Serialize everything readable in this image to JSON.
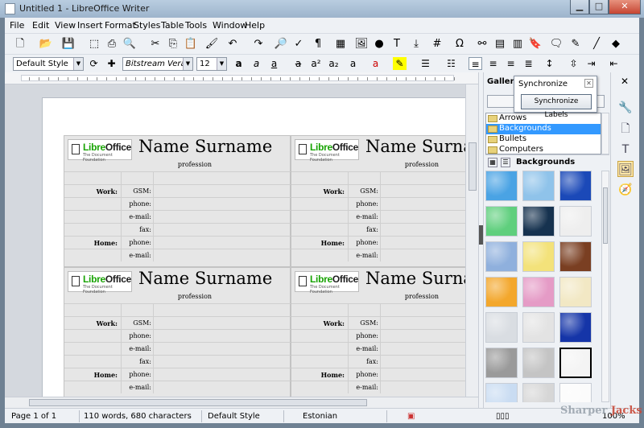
{
  "window": {
    "title": "Untitled 1 - LibreOffice Writer",
    "min": "▁",
    "max": "□",
    "close": "✕"
  },
  "menu": [
    "File",
    "Edit",
    "View",
    "Insert",
    "Format",
    "Styles",
    "Table",
    "Tools",
    "Window",
    "Help"
  ],
  "formatting": {
    "style": "Default Style",
    "font": "Bitstream Vera Sa",
    "size": "12"
  },
  "cards": [
    {
      "logo_libre": "Libre",
      "logo_office": "Office",
      "logo_sub": "The Document Foundation",
      "name": "Name Surname",
      "profession": "profession",
      "rows": [
        {
          "label": "",
          "field": ""
        },
        {
          "label": "Work:",
          "field": "GSM:"
        },
        {
          "label": "",
          "field": "phone:"
        },
        {
          "label": "",
          "field": "e-mail:"
        },
        {
          "label": "",
          "field": "fax:"
        },
        {
          "label": "Home:",
          "field": "phone:"
        },
        {
          "label": "",
          "field": "e-mail:"
        }
      ]
    },
    {
      "logo_libre": "Libre",
      "logo_office": "Office",
      "logo_sub": "The Document Foundation",
      "name": "Name Surname",
      "profession": "profession",
      "rows": [
        {
          "label": "",
          "field": ""
        },
        {
          "label": "Work:",
          "field": "GSM:"
        },
        {
          "label": "",
          "field": "phone:"
        },
        {
          "label": "",
          "field": "e-mail:"
        },
        {
          "label": "",
          "field": "fax:"
        },
        {
          "label": "Home:",
          "field": "phone:"
        },
        {
          "label": "",
          "field": "e-mail:"
        }
      ]
    },
    {
      "logo_libre": "Libre",
      "logo_office": "Office",
      "logo_sub": "The Document Foundation",
      "name": "Name Surname",
      "profession": "profession",
      "rows": [
        {
          "label": "",
          "field": ""
        },
        {
          "label": "Work:",
          "field": "GSM:"
        },
        {
          "label": "",
          "field": "phone:"
        },
        {
          "label": "",
          "field": "e-mail:"
        },
        {
          "label": "",
          "field": "fax:"
        },
        {
          "label": "Home:",
          "field": "phone:"
        },
        {
          "label": "",
          "field": "e-mail:"
        }
      ]
    },
    {
      "logo_libre": "Libre",
      "logo_office": "Office",
      "logo_sub": "The Document Foundation",
      "name": "Name Surname",
      "profession": "profession",
      "rows": [
        {
          "label": "",
          "field": ""
        },
        {
          "label": "Work:",
          "field": "GSM:"
        },
        {
          "label": "",
          "field": "phone:"
        },
        {
          "label": "",
          "field": "e-mail:"
        },
        {
          "label": "",
          "field": "fax:"
        },
        {
          "label": "Home:",
          "field": "phone:"
        },
        {
          "label": "",
          "field": "e-mail:"
        }
      ]
    }
  ],
  "sidebar": {
    "header": "Gallery",
    "themes": [
      {
        "label": "Arrows",
        "selected": false
      },
      {
        "label": "Backgrounds",
        "selected": true
      },
      {
        "label": "Bullets",
        "selected": false
      },
      {
        "label": "Computers",
        "selected": false
      }
    ],
    "current_theme": "Backgrounds",
    "tiles": [
      {
        "name": "water",
        "color": "#4aa3e4"
      },
      {
        "name": "tiles-blue",
        "color": "#8fc3ea"
      },
      {
        "name": "blue-dots",
        "color": "#1b49b8"
      },
      {
        "name": "green-wave",
        "color": "#5fcf7d"
      },
      {
        "name": "night-sky",
        "color": "#16324f"
      },
      {
        "name": "paper-white",
        "color": "#eeeeee"
      },
      {
        "name": "blue-texture",
        "color": "#8fb0dd"
      },
      {
        "name": "cheese",
        "color": "#f3e27a"
      },
      {
        "name": "brown-swirl",
        "color": "#7a3f22"
      },
      {
        "name": "orange",
        "color": "#f3a72c"
      },
      {
        "name": "candy",
        "color": "#e59bc6"
      },
      {
        "name": "flowers",
        "color": "#f2e8c4"
      },
      {
        "name": "crinkled",
        "color": "#d9dde2"
      },
      {
        "name": "paper-grey",
        "color": "#e3e3e3"
      },
      {
        "name": "blue-glitter",
        "color": "#1535a8"
      },
      {
        "name": "granite",
        "color": "#9a9a9a"
      },
      {
        "name": "grey-stone",
        "color": "#c4c4c4"
      },
      {
        "name": "white-grain",
        "color": "#f4f4f4"
      },
      {
        "name": "sky",
        "color": "#c9dcf2"
      },
      {
        "name": "grey-light",
        "color": "#d6d6d6"
      },
      {
        "name": "white",
        "color": "#fbfbfb"
      }
    ],
    "selected_tile": "white-grain"
  },
  "sync_popup": {
    "title": "Synchronize",
    "button": "Synchronize Labels",
    "close": "✕"
  },
  "status": {
    "page": "Page 1 of 1",
    "words": "110 words, 680 characters",
    "style": "Default Style",
    "language": "Estonian",
    "zoom": "100%"
  },
  "watermark": {
    "a": "Sharper",
    "b": "Jacks"
  }
}
